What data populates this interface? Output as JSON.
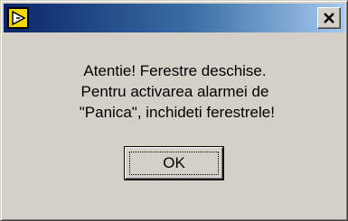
{
  "window": {
    "title": "",
    "icon": "labview-run-arrow-icon",
    "titlebar_color_start": "#0a246a",
    "titlebar_color_end": "#a6caf0",
    "close_icon": "close-icon"
  },
  "message": {
    "lines": [
      "Atentie! Ferestre deschise.",
      "Pentru activarea alarmei de",
      " \"Panica\", inchideti ferestrele!"
    ]
  },
  "buttons": {
    "ok_label": "OK"
  }
}
